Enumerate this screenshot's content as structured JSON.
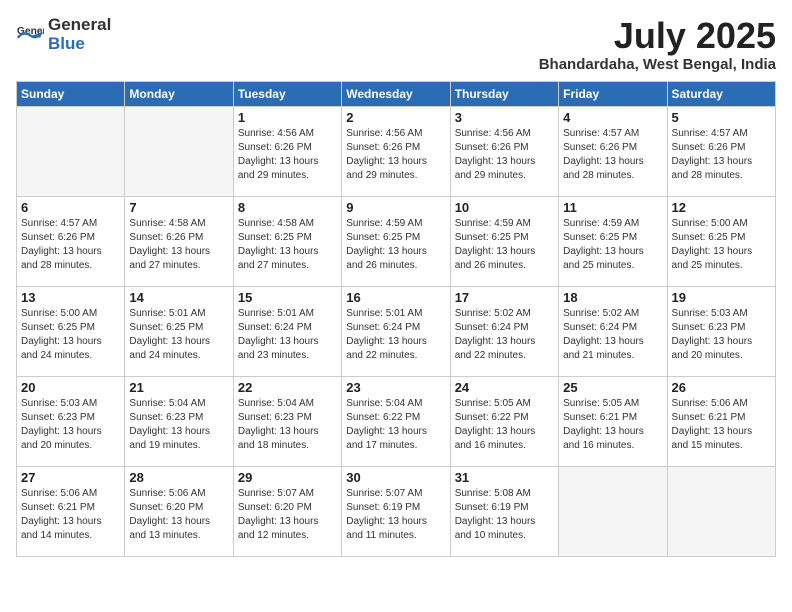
{
  "header": {
    "logo_general": "General",
    "logo_blue": "Blue",
    "month_year": "July 2025",
    "location": "Bhandardaha, West Bengal, India"
  },
  "weekdays": [
    "Sunday",
    "Monday",
    "Tuesday",
    "Wednesday",
    "Thursday",
    "Friday",
    "Saturday"
  ],
  "weeks": [
    [
      {
        "day": "",
        "sunrise": "",
        "sunset": "",
        "daylight": "",
        "empty": true
      },
      {
        "day": "",
        "sunrise": "",
        "sunset": "",
        "daylight": "",
        "empty": true
      },
      {
        "day": "1",
        "sunrise": "Sunrise: 4:56 AM",
        "sunset": "Sunset: 6:26 PM",
        "daylight": "Daylight: 13 hours and 29 minutes.",
        "empty": false
      },
      {
        "day": "2",
        "sunrise": "Sunrise: 4:56 AM",
        "sunset": "Sunset: 6:26 PM",
        "daylight": "Daylight: 13 hours and 29 minutes.",
        "empty": false
      },
      {
        "day": "3",
        "sunrise": "Sunrise: 4:56 AM",
        "sunset": "Sunset: 6:26 PM",
        "daylight": "Daylight: 13 hours and 29 minutes.",
        "empty": false
      },
      {
        "day": "4",
        "sunrise": "Sunrise: 4:57 AM",
        "sunset": "Sunset: 6:26 PM",
        "daylight": "Daylight: 13 hours and 28 minutes.",
        "empty": false
      },
      {
        "day": "5",
        "sunrise": "Sunrise: 4:57 AM",
        "sunset": "Sunset: 6:26 PM",
        "daylight": "Daylight: 13 hours and 28 minutes.",
        "empty": false
      }
    ],
    [
      {
        "day": "6",
        "sunrise": "Sunrise: 4:57 AM",
        "sunset": "Sunset: 6:26 PM",
        "daylight": "Daylight: 13 hours and 28 minutes.",
        "empty": false
      },
      {
        "day": "7",
        "sunrise": "Sunrise: 4:58 AM",
        "sunset": "Sunset: 6:26 PM",
        "daylight": "Daylight: 13 hours and 27 minutes.",
        "empty": false
      },
      {
        "day": "8",
        "sunrise": "Sunrise: 4:58 AM",
        "sunset": "Sunset: 6:25 PM",
        "daylight": "Daylight: 13 hours and 27 minutes.",
        "empty": false
      },
      {
        "day": "9",
        "sunrise": "Sunrise: 4:59 AM",
        "sunset": "Sunset: 6:25 PM",
        "daylight": "Daylight: 13 hours and 26 minutes.",
        "empty": false
      },
      {
        "day": "10",
        "sunrise": "Sunrise: 4:59 AM",
        "sunset": "Sunset: 6:25 PM",
        "daylight": "Daylight: 13 hours and 26 minutes.",
        "empty": false
      },
      {
        "day": "11",
        "sunrise": "Sunrise: 4:59 AM",
        "sunset": "Sunset: 6:25 PM",
        "daylight": "Daylight: 13 hours and 25 minutes.",
        "empty": false
      },
      {
        "day": "12",
        "sunrise": "Sunrise: 5:00 AM",
        "sunset": "Sunset: 6:25 PM",
        "daylight": "Daylight: 13 hours and 25 minutes.",
        "empty": false
      }
    ],
    [
      {
        "day": "13",
        "sunrise": "Sunrise: 5:00 AM",
        "sunset": "Sunset: 6:25 PM",
        "daylight": "Daylight: 13 hours and 24 minutes.",
        "empty": false
      },
      {
        "day": "14",
        "sunrise": "Sunrise: 5:01 AM",
        "sunset": "Sunset: 6:25 PM",
        "daylight": "Daylight: 13 hours and 24 minutes.",
        "empty": false
      },
      {
        "day": "15",
        "sunrise": "Sunrise: 5:01 AM",
        "sunset": "Sunset: 6:24 PM",
        "daylight": "Daylight: 13 hours and 23 minutes.",
        "empty": false
      },
      {
        "day": "16",
        "sunrise": "Sunrise: 5:01 AM",
        "sunset": "Sunset: 6:24 PM",
        "daylight": "Daylight: 13 hours and 22 minutes.",
        "empty": false
      },
      {
        "day": "17",
        "sunrise": "Sunrise: 5:02 AM",
        "sunset": "Sunset: 6:24 PM",
        "daylight": "Daylight: 13 hours and 22 minutes.",
        "empty": false
      },
      {
        "day": "18",
        "sunrise": "Sunrise: 5:02 AM",
        "sunset": "Sunset: 6:24 PM",
        "daylight": "Daylight: 13 hours and 21 minutes.",
        "empty": false
      },
      {
        "day": "19",
        "sunrise": "Sunrise: 5:03 AM",
        "sunset": "Sunset: 6:23 PM",
        "daylight": "Daylight: 13 hours and 20 minutes.",
        "empty": false
      }
    ],
    [
      {
        "day": "20",
        "sunrise": "Sunrise: 5:03 AM",
        "sunset": "Sunset: 6:23 PM",
        "daylight": "Daylight: 13 hours and 20 minutes.",
        "empty": false
      },
      {
        "day": "21",
        "sunrise": "Sunrise: 5:04 AM",
        "sunset": "Sunset: 6:23 PM",
        "daylight": "Daylight: 13 hours and 19 minutes.",
        "empty": false
      },
      {
        "day": "22",
        "sunrise": "Sunrise: 5:04 AM",
        "sunset": "Sunset: 6:23 PM",
        "daylight": "Daylight: 13 hours and 18 minutes.",
        "empty": false
      },
      {
        "day": "23",
        "sunrise": "Sunrise: 5:04 AM",
        "sunset": "Sunset: 6:22 PM",
        "daylight": "Daylight: 13 hours and 17 minutes.",
        "empty": false
      },
      {
        "day": "24",
        "sunrise": "Sunrise: 5:05 AM",
        "sunset": "Sunset: 6:22 PM",
        "daylight": "Daylight: 13 hours and 16 minutes.",
        "empty": false
      },
      {
        "day": "25",
        "sunrise": "Sunrise: 5:05 AM",
        "sunset": "Sunset: 6:21 PM",
        "daylight": "Daylight: 13 hours and 16 minutes.",
        "empty": false
      },
      {
        "day": "26",
        "sunrise": "Sunrise: 5:06 AM",
        "sunset": "Sunset: 6:21 PM",
        "daylight": "Daylight: 13 hours and 15 minutes.",
        "empty": false
      }
    ],
    [
      {
        "day": "27",
        "sunrise": "Sunrise: 5:06 AM",
        "sunset": "Sunset: 6:21 PM",
        "daylight": "Daylight: 13 hours and 14 minutes.",
        "empty": false
      },
      {
        "day": "28",
        "sunrise": "Sunrise: 5:06 AM",
        "sunset": "Sunset: 6:20 PM",
        "daylight": "Daylight: 13 hours and 13 minutes.",
        "empty": false
      },
      {
        "day": "29",
        "sunrise": "Sunrise: 5:07 AM",
        "sunset": "Sunset: 6:20 PM",
        "daylight": "Daylight: 13 hours and 12 minutes.",
        "empty": false
      },
      {
        "day": "30",
        "sunrise": "Sunrise: 5:07 AM",
        "sunset": "Sunset: 6:19 PM",
        "daylight": "Daylight: 13 hours and 11 minutes.",
        "empty": false
      },
      {
        "day": "31",
        "sunrise": "Sunrise: 5:08 AM",
        "sunset": "Sunset: 6:19 PM",
        "daylight": "Daylight: 13 hours and 10 minutes.",
        "empty": false
      },
      {
        "day": "",
        "sunrise": "",
        "sunset": "",
        "daylight": "",
        "empty": true
      },
      {
        "day": "",
        "sunrise": "",
        "sunset": "",
        "daylight": "",
        "empty": true
      }
    ]
  ]
}
